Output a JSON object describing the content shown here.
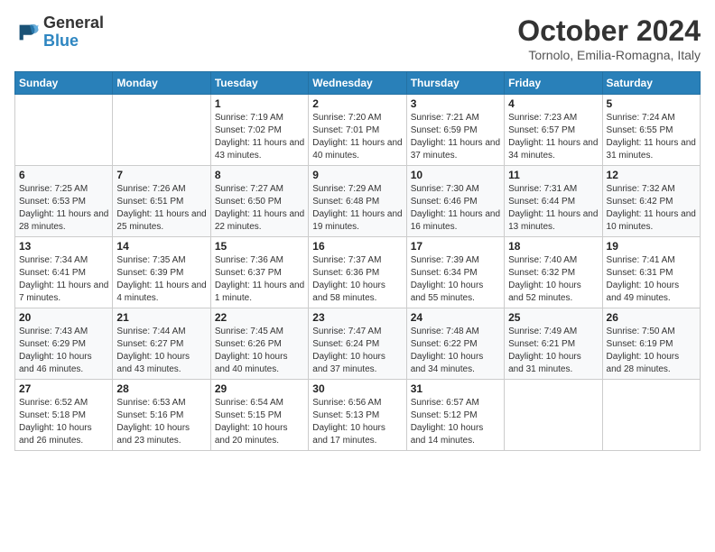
{
  "logo": {
    "line1": "General",
    "line2": "Blue"
  },
  "title": "October 2024",
  "subtitle": "Tornolo, Emilia-Romagna, Italy",
  "days_of_week": [
    "Sunday",
    "Monday",
    "Tuesday",
    "Wednesday",
    "Thursday",
    "Friday",
    "Saturday"
  ],
  "weeks": [
    [
      {
        "day": "",
        "info": ""
      },
      {
        "day": "",
        "info": ""
      },
      {
        "day": "1",
        "info": "Sunrise: 7:19 AM\nSunset: 7:02 PM\nDaylight: 11 hours and 43 minutes."
      },
      {
        "day": "2",
        "info": "Sunrise: 7:20 AM\nSunset: 7:01 PM\nDaylight: 11 hours and 40 minutes."
      },
      {
        "day": "3",
        "info": "Sunrise: 7:21 AM\nSunset: 6:59 PM\nDaylight: 11 hours and 37 minutes."
      },
      {
        "day": "4",
        "info": "Sunrise: 7:23 AM\nSunset: 6:57 PM\nDaylight: 11 hours and 34 minutes."
      },
      {
        "day": "5",
        "info": "Sunrise: 7:24 AM\nSunset: 6:55 PM\nDaylight: 11 hours and 31 minutes."
      }
    ],
    [
      {
        "day": "6",
        "info": "Sunrise: 7:25 AM\nSunset: 6:53 PM\nDaylight: 11 hours and 28 minutes."
      },
      {
        "day": "7",
        "info": "Sunrise: 7:26 AM\nSunset: 6:51 PM\nDaylight: 11 hours and 25 minutes."
      },
      {
        "day": "8",
        "info": "Sunrise: 7:27 AM\nSunset: 6:50 PM\nDaylight: 11 hours and 22 minutes."
      },
      {
        "day": "9",
        "info": "Sunrise: 7:29 AM\nSunset: 6:48 PM\nDaylight: 11 hours and 19 minutes."
      },
      {
        "day": "10",
        "info": "Sunrise: 7:30 AM\nSunset: 6:46 PM\nDaylight: 11 hours and 16 minutes."
      },
      {
        "day": "11",
        "info": "Sunrise: 7:31 AM\nSunset: 6:44 PM\nDaylight: 11 hours and 13 minutes."
      },
      {
        "day": "12",
        "info": "Sunrise: 7:32 AM\nSunset: 6:42 PM\nDaylight: 11 hours and 10 minutes."
      }
    ],
    [
      {
        "day": "13",
        "info": "Sunrise: 7:34 AM\nSunset: 6:41 PM\nDaylight: 11 hours and 7 minutes."
      },
      {
        "day": "14",
        "info": "Sunrise: 7:35 AM\nSunset: 6:39 PM\nDaylight: 11 hours and 4 minutes."
      },
      {
        "day": "15",
        "info": "Sunrise: 7:36 AM\nSunset: 6:37 PM\nDaylight: 11 hours and 1 minute."
      },
      {
        "day": "16",
        "info": "Sunrise: 7:37 AM\nSunset: 6:36 PM\nDaylight: 10 hours and 58 minutes."
      },
      {
        "day": "17",
        "info": "Sunrise: 7:39 AM\nSunset: 6:34 PM\nDaylight: 10 hours and 55 minutes."
      },
      {
        "day": "18",
        "info": "Sunrise: 7:40 AM\nSunset: 6:32 PM\nDaylight: 10 hours and 52 minutes."
      },
      {
        "day": "19",
        "info": "Sunrise: 7:41 AM\nSunset: 6:31 PM\nDaylight: 10 hours and 49 minutes."
      }
    ],
    [
      {
        "day": "20",
        "info": "Sunrise: 7:43 AM\nSunset: 6:29 PM\nDaylight: 10 hours and 46 minutes."
      },
      {
        "day": "21",
        "info": "Sunrise: 7:44 AM\nSunset: 6:27 PM\nDaylight: 10 hours and 43 minutes."
      },
      {
        "day": "22",
        "info": "Sunrise: 7:45 AM\nSunset: 6:26 PM\nDaylight: 10 hours and 40 minutes."
      },
      {
        "day": "23",
        "info": "Sunrise: 7:47 AM\nSunset: 6:24 PM\nDaylight: 10 hours and 37 minutes."
      },
      {
        "day": "24",
        "info": "Sunrise: 7:48 AM\nSunset: 6:22 PM\nDaylight: 10 hours and 34 minutes."
      },
      {
        "day": "25",
        "info": "Sunrise: 7:49 AM\nSunset: 6:21 PM\nDaylight: 10 hours and 31 minutes."
      },
      {
        "day": "26",
        "info": "Sunrise: 7:50 AM\nSunset: 6:19 PM\nDaylight: 10 hours and 28 minutes."
      }
    ],
    [
      {
        "day": "27",
        "info": "Sunrise: 6:52 AM\nSunset: 5:18 PM\nDaylight: 10 hours and 26 minutes."
      },
      {
        "day": "28",
        "info": "Sunrise: 6:53 AM\nSunset: 5:16 PM\nDaylight: 10 hours and 23 minutes."
      },
      {
        "day": "29",
        "info": "Sunrise: 6:54 AM\nSunset: 5:15 PM\nDaylight: 10 hours and 20 minutes."
      },
      {
        "day": "30",
        "info": "Sunrise: 6:56 AM\nSunset: 5:13 PM\nDaylight: 10 hours and 17 minutes."
      },
      {
        "day": "31",
        "info": "Sunrise: 6:57 AM\nSunset: 5:12 PM\nDaylight: 10 hours and 14 minutes."
      },
      {
        "day": "",
        "info": ""
      },
      {
        "day": "",
        "info": ""
      }
    ]
  ]
}
